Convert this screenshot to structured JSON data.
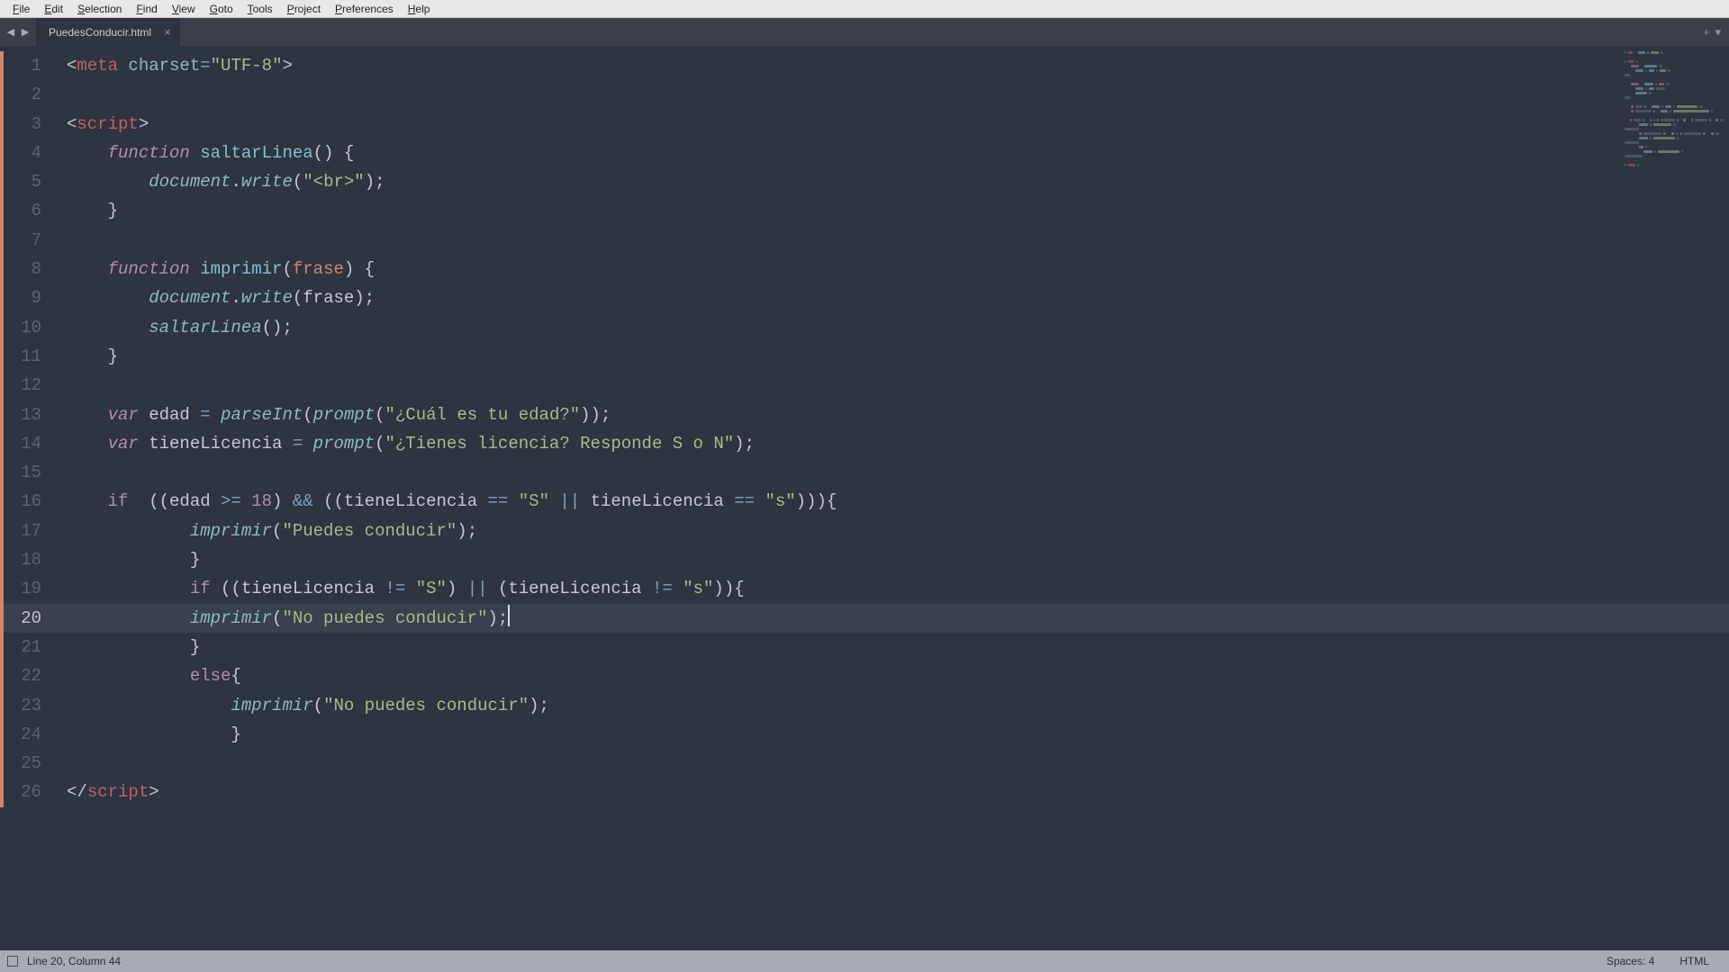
{
  "menu": {
    "items": [
      "File",
      "Edit",
      "Selection",
      "Find",
      "View",
      "Goto",
      "Tools",
      "Project",
      "Preferences",
      "Help"
    ]
  },
  "tabs": {
    "active": {
      "title": "PuedesConducir.html"
    }
  },
  "gutter": {
    "lines": 26,
    "active": 20,
    "modified": [
      1,
      2,
      3,
      4,
      5,
      6,
      7,
      8,
      9,
      10,
      11,
      12,
      13,
      14,
      15,
      16,
      17,
      18,
      19,
      20,
      21,
      22,
      23,
      24,
      25,
      26
    ]
  },
  "statusbar": {
    "position": "Line 20, Column 44",
    "spaces": "Spaces: 4",
    "syntax": "HTML"
  },
  "code_tokens": [
    [
      [
        "p",
        "<"
      ],
      [
        "tag",
        "meta"
      ],
      [
        "p",
        " "
      ],
      [
        "attr",
        "charset"
      ],
      [
        "op",
        "="
      ],
      [
        "str",
        "\"UTF-8\""
      ],
      [
        "p",
        ">"
      ]
    ],
    [],
    [
      [
        "p",
        "<"
      ],
      [
        "tag",
        "script"
      ],
      [
        "p",
        ">"
      ]
    ],
    [
      [
        "p",
        "    "
      ],
      [
        "kw",
        "function"
      ],
      [
        "p",
        " "
      ],
      [
        "fnname",
        "saltarLinea"
      ],
      [
        "p",
        "() {"
      ]
    ],
    [
      [
        "p",
        "        "
      ],
      [
        "obj",
        "document"
      ],
      [
        "p",
        "."
      ],
      [
        "fncall",
        "write"
      ],
      [
        "p",
        "("
      ],
      [
        "str",
        "\"<br>\""
      ],
      [
        "p",
        ");"
      ]
    ],
    [
      [
        "p",
        "    }"
      ]
    ],
    [],
    [
      [
        "p",
        "    "
      ],
      [
        "kw",
        "function"
      ],
      [
        "p",
        " "
      ],
      [
        "fnname",
        "imprimir"
      ],
      [
        "p",
        "("
      ],
      [
        "param",
        "frase"
      ],
      [
        "p",
        ") {"
      ]
    ],
    [
      [
        "p",
        "        "
      ],
      [
        "obj",
        "document"
      ],
      [
        "p",
        "."
      ],
      [
        "fncall",
        "write"
      ],
      [
        "p",
        "(frase);"
      ]
    ],
    [
      [
        "p",
        "        "
      ],
      [
        "fncall",
        "saltarLinea"
      ],
      [
        "p",
        "();"
      ]
    ],
    [
      [
        "p",
        "    }"
      ]
    ],
    [],
    [
      [
        "p",
        "    "
      ],
      [
        "kw",
        "var"
      ],
      [
        "p",
        " edad "
      ],
      [
        "op",
        "="
      ],
      [
        "p",
        " "
      ],
      [
        "fncall",
        "parseInt"
      ],
      [
        "p",
        "("
      ],
      [
        "fncall",
        "prompt"
      ],
      [
        "p",
        "("
      ],
      [
        "str",
        "\"¿Cuál es tu edad?\""
      ],
      [
        "p",
        "));"
      ]
    ],
    [
      [
        "p",
        "    "
      ],
      [
        "kw",
        "var"
      ],
      [
        "p",
        " tieneLicencia "
      ],
      [
        "op",
        "="
      ],
      [
        "p",
        " "
      ],
      [
        "fncall",
        "prompt"
      ],
      [
        "p",
        "("
      ],
      [
        "str",
        "\"¿Tienes licencia? Responde S o N\""
      ],
      [
        "p",
        ");"
      ]
    ],
    [],
    [
      [
        "p",
        "    "
      ],
      [
        "kw2",
        "if"
      ],
      [
        "p",
        "  ((edad "
      ],
      [
        "op",
        ">="
      ],
      [
        "p",
        " "
      ],
      [
        "num",
        "18"
      ],
      [
        "p",
        ") "
      ],
      [
        "op",
        "&&"
      ],
      [
        "p",
        " ((tieneLicencia "
      ],
      [
        "op",
        "=="
      ],
      [
        "p",
        " "
      ],
      [
        "str",
        "\"S\""
      ],
      [
        "p",
        " "
      ],
      [
        "op",
        "||"
      ],
      [
        "p",
        " tieneLicencia "
      ],
      [
        "op",
        "=="
      ],
      [
        "p",
        " "
      ],
      [
        "str",
        "\"s\""
      ],
      [
        "p",
        "))){"
      ]
    ],
    [
      [
        "p",
        "            "
      ],
      [
        "fncall",
        "imprimir"
      ],
      [
        "p",
        "("
      ],
      [
        "str",
        "\"Puedes conducir\""
      ],
      [
        "p",
        ");"
      ]
    ],
    [
      [
        "p",
        "            }"
      ]
    ],
    [
      [
        "p",
        "            "
      ],
      [
        "kw2",
        "if"
      ],
      [
        "p",
        " ((tieneLicencia "
      ],
      [
        "op",
        "!="
      ],
      [
        "p",
        " "
      ],
      [
        "str",
        "\"S\""
      ],
      [
        "p",
        ") "
      ],
      [
        "op",
        "||"
      ],
      [
        "p",
        " (tieneLicencia "
      ],
      [
        "op",
        "!="
      ],
      [
        "p",
        " "
      ],
      [
        "str",
        "\"s\""
      ],
      [
        "p",
        ")){"
      ]
    ],
    [
      [
        "p",
        "            "
      ],
      [
        "fncall",
        "imprimir"
      ],
      [
        "p",
        "("
      ],
      [
        "str",
        "\"No puedes conducir\""
      ],
      [
        "p",
        ");"
      ]
    ],
    [
      [
        "p",
        "            }"
      ]
    ],
    [
      [
        "p",
        "            "
      ],
      [
        "kw2",
        "else"
      ],
      [
        "p",
        "{"
      ]
    ],
    [
      [
        "p",
        "                "
      ],
      [
        "fncall",
        "imprimir"
      ],
      [
        "p",
        "("
      ],
      [
        "str",
        "\"No puedes conducir\""
      ],
      [
        "p",
        ");"
      ]
    ],
    [
      [
        "p",
        "                }"
      ]
    ],
    [],
    [
      [
        "p",
        "</"
      ],
      [
        "tag",
        "script"
      ],
      [
        "p",
        ">"
      ]
    ]
  ],
  "minimap_colors": [
    "#bf616a",
    "#8fbcbb",
    "#a3be8c",
    "#b48ead",
    "#88c0d0",
    "#d8dee9"
  ]
}
